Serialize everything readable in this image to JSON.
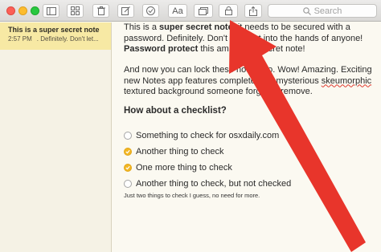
{
  "toolbar": {
    "format_label": "Aa",
    "search_placeholder": "Search"
  },
  "sidebar": {
    "notes": [
      {
        "title": "This is a super secret note",
        "time": "2:57 PM",
        "preview": ". Definitely. Don't let..."
      }
    ]
  },
  "note": {
    "p1_a": "This is a ",
    "p1_b": "super secret note",
    "p1_c": ", it needs to be secured with a password. Definitely. Don't let it get into the hands of anyone! ",
    "p1_d": "Password protect",
    "p1_e": " this amazingly secret note!",
    "p2_a": "And now you can lock these notes too. Wow! Amazing. Exciting new Notes app features complete with mysterious ",
    "p2_b": "skeumorphic",
    "p2_c": " textured background someone forgot to remove.",
    "heading": "How about a checklist?",
    "checklist": [
      {
        "text": "Something to check for osxdaily.com",
        "checked": false
      },
      {
        "text": "Another thing to check",
        "checked": true
      },
      {
        "text": "One more thing to check",
        "checked": true
      },
      {
        "text": "Another thing to check, but not checked",
        "checked": false
      }
    ],
    "footnote": "Just two things to check I guess, no need for more."
  },
  "colors": {
    "arrow": "#e8352b",
    "check_fill": "#f2b624",
    "selected_note": "#f7e9a4"
  }
}
